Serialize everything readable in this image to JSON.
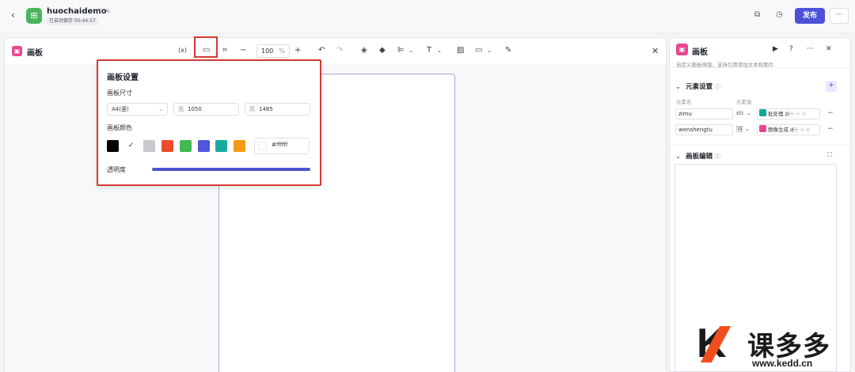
{
  "topbar": {
    "app_name": "huochaidemo",
    "autosave": "已自动保存 00:44:57",
    "publish_label": "发布",
    "more_label": "···"
  },
  "editor": {
    "title": "画板",
    "formula_label": "(x)",
    "zoom_value": "100",
    "zoom_unit": "%",
    "text_tool_label": "T"
  },
  "popup": {
    "title": "画板设置",
    "size_label": "画板尺寸",
    "size_preset": "A4(竖)",
    "width_prefix": "宽",
    "width_value": "1050",
    "height_prefix": "高",
    "height_value": "1485",
    "color_label": "画板颜色",
    "swatches": [
      "#000000",
      "#ffffff",
      "#c8c9cc",
      "#ee4b2b",
      "#3fb950",
      "#5156dc",
      "#18a9a0",
      "#f59a16"
    ],
    "selected_swatch": 1,
    "hex_value": "#ffffff",
    "opacity_label": "透明度",
    "opacity": 1.0
  },
  "right_panel": {
    "title": "画板",
    "description": "自定义画板排版，支持引用添加文本和图片",
    "elements_section": {
      "title": "元素设置",
      "col_name": "元素名",
      "col_value": "元素值",
      "rows": [
        {
          "name": "zimu",
          "type": "str.",
          "source": "批处理",
          "ref": "zi···",
          "chip_color": "#12a79a"
        },
        {
          "name": "wenshengtu",
          "type": "🖼",
          "source": "图像生成",
          "ref": "d···",
          "chip_color": "#e9468f"
        }
      ]
    },
    "edit_section": {
      "title": "画板编辑"
    }
  },
  "watermark": {
    "brand": "课多多",
    "url": "www.kedd.cn"
  }
}
